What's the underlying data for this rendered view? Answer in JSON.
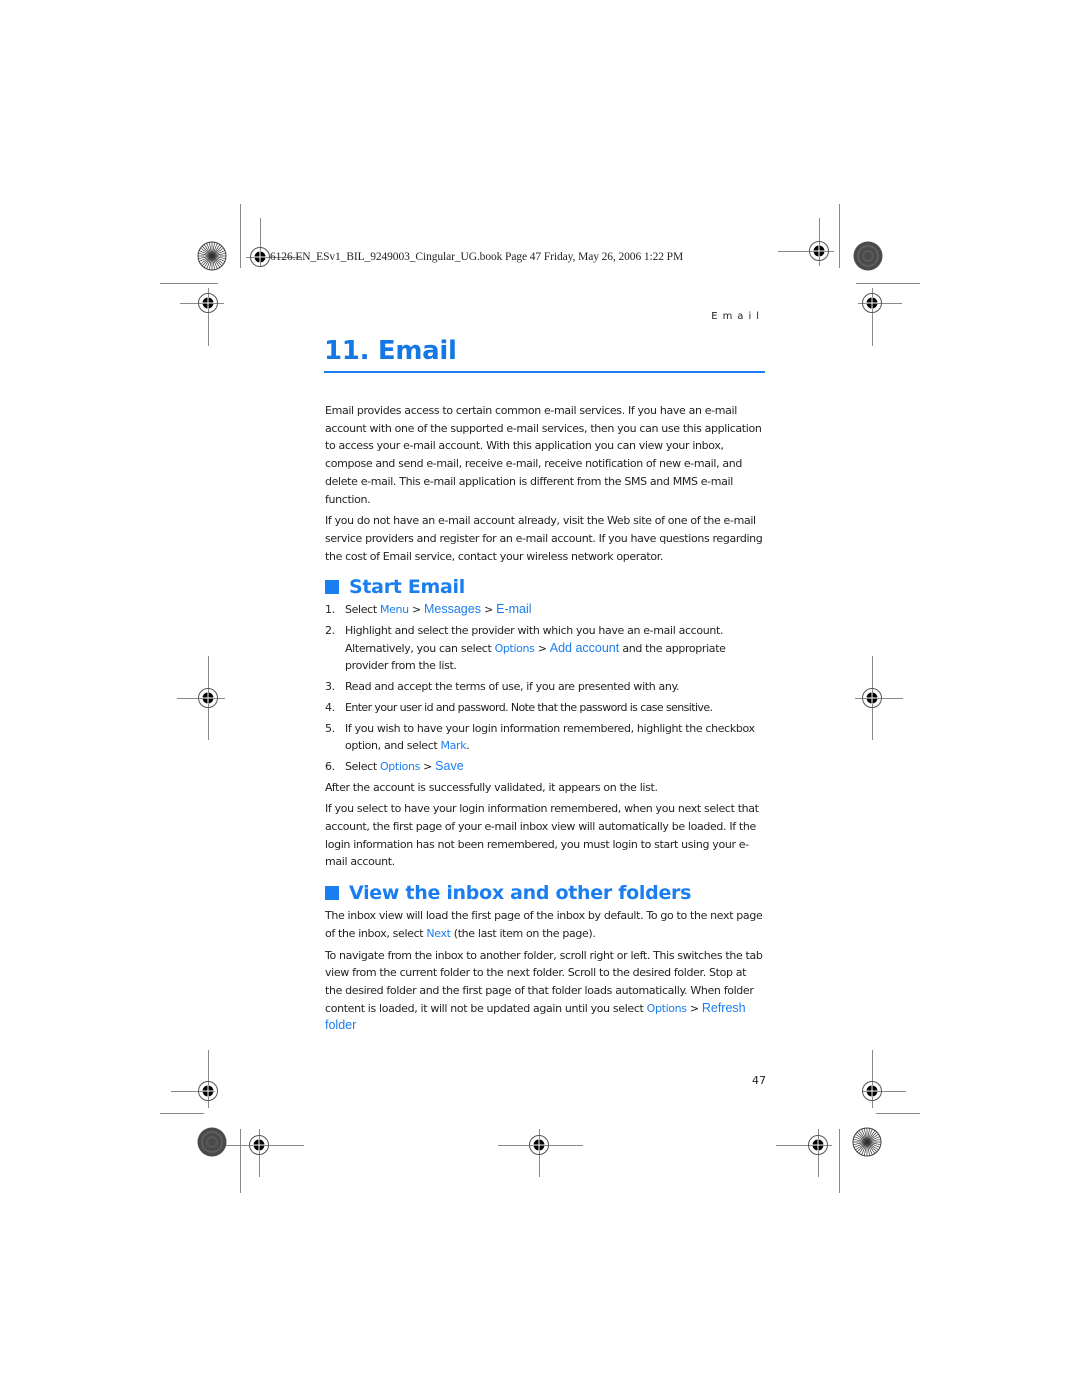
{
  "print_header": "6126.EN_ESv1_BIL_9249003_Cingular_UG.book  Page 47  Friday, May 26, 2006  1:22 PM",
  "running_head": "Email",
  "chapter": {
    "title": "11. Email"
  },
  "intro": {
    "p1": "Email provides access to certain common e-mail services. If you have an e-mail account with one of the supported e-mail services, then you can use this application to access your e-mail account. With this application you can view your inbox, compose and send e-mail, receive e-mail, receive notification of new e-mail, and delete e-mail. This e-mail application is different from the SMS and MMS e-mail function.",
    "p2": "If you do not have an e-mail account already, visit the Web site of one of the e-mail service providers and register for an e-mail account. If you have questions regarding the cost of Email service, contact your wireless network operator."
  },
  "start_email": {
    "heading": "Start Email",
    "steps": [
      {
        "num": "1.",
        "pre": "Select ",
        "link1": "Menu",
        "sep1": " > ",
        "link2": "Messages",
        "sep2": " > ",
        "link3": "E-mail"
      },
      {
        "num": "2.",
        "pre": "Highlight and select the provider with which you have an e-mail account. Alternatively, you can select ",
        "link1": "Options",
        "sep1": " > ",
        "link2": "Add account",
        "post": " and the appropriate provider from the list."
      },
      {
        "num": "3.",
        "text": "Read and accept the terms of use, if you are presented with any."
      },
      {
        "num": "4.",
        "text": "Enter your user id and password. Note that the password is case sensitive."
      },
      {
        "num": "5.",
        "pre": "If you wish to have your login information remembered, highlight the checkbox option, and select ",
        "link1": "Mark",
        "post": "."
      },
      {
        "num": "6.",
        "pre": "Select ",
        "link1": "Options",
        "sep1": " > ",
        "link2": "Save"
      }
    ],
    "after1": "After the account is successfully validated, it appears on the list.",
    "after2": "If you select to have your login information remembered, when you next select that account, the first page of your e-mail inbox view will automatically be loaded. If the login information has not been remembered, you must login to start using your e-mail account."
  },
  "view_inbox": {
    "heading": "View the inbox and other folders",
    "p1_pre": "The inbox view will load the first page of the inbox by default. To go to the next page of the inbox, select ",
    "p1_link": "Next",
    "p1_post": " (the last item on the page).",
    "p2": "To navigate from the inbox to another folder, scroll right or left. This switches the tab view from the current folder to the next folder. Scroll to the desired folder. Stop at the desired folder and the first page of that folder loads automatically. When folder content is loaded, it will not be updated again until you select ",
    "p2_link1": "Options",
    "p2_sep": " > ",
    "p2_link2": "Refresh folder"
  },
  "page_number": "47",
  "colors": {
    "accent": "#1a7ef0",
    "text": "#231f20",
    "crop_marks": "#8a8a8a"
  }
}
